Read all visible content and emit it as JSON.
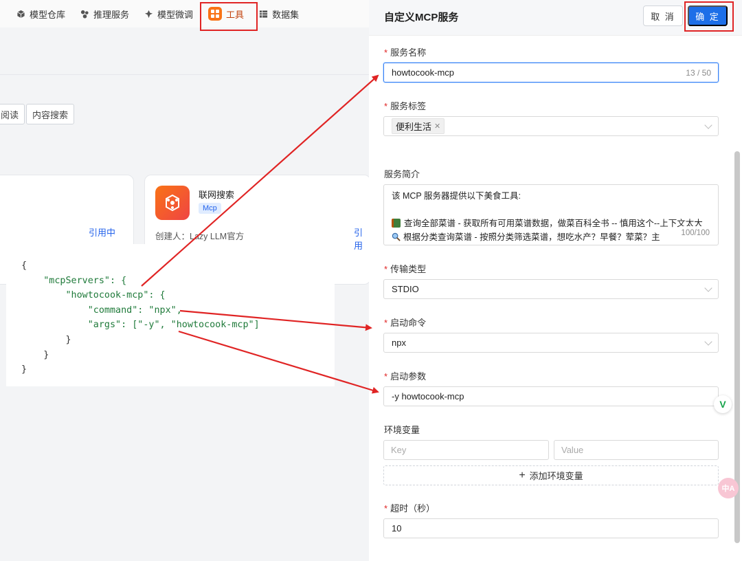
{
  "topnav": {
    "items": [
      {
        "label": "模型仓库",
        "icon": "cube-icon"
      },
      {
        "label": "推理服务",
        "icon": "nodes-icon"
      },
      {
        "label": "模型微调",
        "icon": "tune-icon"
      },
      {
        "label": "工具",
        "icon": "tools-grid-icon"
      },
      {
        "label": "数据集",
        "icon": "table-icon"
      }
    ],
    "active": "工具"
  },
  "filters": {
    "chip_partial": "阅读",
    "chip_search": "内容搜索"
  },
  "cards": {
    "a": {
      "ref_label": "引用中"
    },
    "b": {
      "title": "联网搜索",
      "tag": "Mcp",
      "creator": "创建人：Lazy LLM官方",
      "ref_label": "引用"
    }
  },
  "code_snippet": {
    "lines": [
      "{",
      "    \"mcpServers\": {",
      "        \"howtocook-mcp\": {",
      "            \"command\": \"npx\",",
      "            \"args\": [\"-y\", \"howtocook-mcp\"]",
      "        }",
      "    }",
      "}"
    ]
  },
  "drawer": {
    "title": "自定义MCP服务",
    "cancel_label": "取 消",
    "confirm_label": "确 定",
    "fields": {
      "service_name": {
        "label": "服务名称",
        "value": "howtocook-mcp",
        "count": "13 / 50"
      },
      "service_tag": {
        "label": "服务标签",
        "tag": "便利生活"
      },
      "service_desc": {
        "label": "服务简介",
        "line1": "该 MCP 服务器提供以下美食工具:",
        "line2": "",
        "line3": "查询全部菜谱 - 获取所有可用菜谱数据，做菜百科全书 -- 慎用这个--上下文太大",
        "line4": "根据分类查询菜谱 - 按照分类筛选菜谱，想吃水产？早餐？荤菜？主",
        "count": "100/100"
      },
      "transport": {
        "label": "传输类型",
        "value": "STDIO"
      },
      "command": {
        "label": "启动命令",
        "value": "npx"
      },
      "args": {
        "label": "启动参数",
        "value": "-y howtocook-mcp"
      },
      "env": {
        "label": "环境变量",
        "key_placeholder": "Key",
        "value_placeholder": "Value",
        "add_label": "添加环境变量"
      },
      "timeout": {
        "label": "超时（秒）",
        "value": "10"
      }
    }
  },
  "floating": {
    "v_icon": "V",
    "zh_icon": "中A"
  },
  "colors": {
    "primary": "#1d6fe8",
    "annotation": "#e02424",
    "required": "#e02424",
    "code_green": "#1f7a3a"
  }
}
